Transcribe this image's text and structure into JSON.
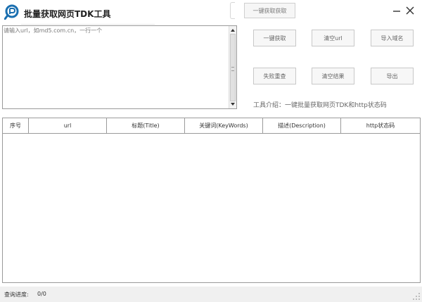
{
  "app": {
    "title": "批量获取网页TDK工具",
    "logo_icon": "app-logo-icon"
  },
  "window_controls": {
    "minimize_icon": "minimize-icon",
    "close_icon": "close-icon"
  },
  "top_button": {
    "label": "一键获取获取"
  },
  "url_input": {
    "placeholder": "请输入url，如md5.com.cn，一行一个",
    "value": ""
  },
  "buttons": {
    "fetch": "一键获取",
    "clear_url": "清空url",
    "import_domain": "导入域名",
    "retry_failed": "失败重查",
    "clear_results": "清空结果",
    "export": "导出"
  },
  "intro": {
    "text": "工具介绍：一键批量获取网页TDK和http状态码"
  },
  "table": {
    "columns": [
      "序号",
      "url",
      "标题(Title)",
      "关键词(KeyWords)",
      "描述(Description)",
      "http状态码"
    ],
    "rows": []
  },
  "status": {
    "label": "查询进度:",
    "value": "0/0"
  },
  "colors": {
    "accent": "#1a6fb0",
    "border": "#9a9a9a",
    "button_bg": "#f7f7f7"
  }
}
